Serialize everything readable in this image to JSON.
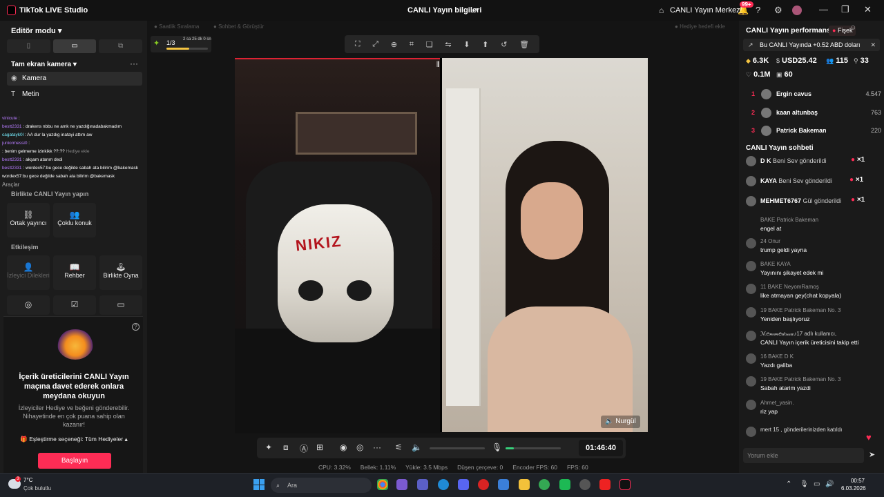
{
  "titlebar": {
    "app_title": "TikTok LIVE Studio",
    "center_title": "CANLI Yayın bilgileri",
    "live_center": "CANLI Yayın Merkezi",
    "notif_count": "99+"
  },
  "left": {
    "edit_mode": "Editör modu",
    "scene_label": "Tam ekran kamera",
    "sources": [
      "Kamera",
      "Metin"
    ],
    "chat_overlay": [
      {
        "name": "vinicute",
        "text": ""
      },
      {
        "name": "bestt2331",
        "text": "drakens nbbu ne amk ne yazdığınadabakmadım"
      },
      {
        "name": "cagatayk0l",
        "text": "AA dur la yazdıg inatayi attım aw"
      },
      {
        "name": "juniormessi0",
        "text": ""
      },
      {
        "name": "",
        "text": "benim gelmeme izinkikk ??:??"
      },
      {
        "name": "bestt2331",
        "text": "akşam atarım dedi"
      },
      {
        "name": "bestt2331",
        "text": "wordex57:bu gece değilde sabah ata bilirim @bakemask"
      },
      {
        "name": "",
        "text": "wordex57:bu gece değilde sabah ata bilirim @bakemask"
      }
    ],
    "chat_overlay_ghost": "Hediye ekle",
    "tools_label": "Araçlar",
    "together_section": "Birlikte CANLI Yayın yapın",
    "together_cards": [
      "Ortak yayıncı",
      "Çoklu konuk"
    ],
    "interaction_section": "Etkileşim",
    "interaction_cards": [
      "İzleyici Dilekleri",
      "Rehber",
      "Birlikte Oyna"
    ],
    "promo": {
      "title": "İçerik üreticilerini CANLI Yayın maçına davet ederek onlara meydana okuyun",
      "subtitle": "İzleyiciler Hediye ve beğeni gönderebilir. Nihayetinde en çok puana sahip olan kazanır!",
      "match_option": "Eşleştirme seçeneği: Tüm Hediyeler",
      "button": "Başlayın"
    }
  },
  "stage": {
    "ghost_tabs": [
      "Saatlik Sıralama",
      "Sohbet & Görüştür"
    ],
    "ghost_right": "Hediye hedefi ekle",
    "goal_fraction": "1/3",
    "goal_time": "2 sa 25 dk 0 sn",
    "goal_progress": 0.55,
    "guest_name": "Nurgül",
    "beanie_text": "NIKIZ",
    "timer": "01:46:40",
    "stats": {
      "cpu": "CPU: 3.32%",
      "memory": "Bellek: 1.11%",
      "upload": "Yükle: 3.5 Mbps",
      "dropped": "Düşen çerçeve: 0",
      "encoder_fps": "Encoder FPS: 60",
      "fps": "FPS: 60"
    },
    "mic_level": 0.15
  },
  "right": {
    "perf_title": "CANLI Yayın performansı",
    "fisek": "Fişek",
    "banner": "Bu CANLI Yayında +0.52 ABD doları",
    "stats": {
      "diamonds": "6.3K",
      "usd": "USD25.42",
      "viewers": "115",
      "new": "33",
      "likes": "0.1M",
      "shares": "60"
    },
    "ranking": [
      {
        "rank": "1",
        "name": "Ergin cavus",
        "value": "4.547"
      },
      {
        "rank": "2",
        "name": "kaan altunbaş",
        "value": "763"
      },
      {
        "rank": "3",
        "name": "Patrick Bakeman",
        "value": "220"
      }
    ],
    "chat_title": "CANLI Yayın sohbeti",
    "gifts": [
      {
        "user": "D K",
        "text": "Beni Sev gönderildi",
        "count": "×1"
      },
      {
        "user": "KAYA",
        "text": "Beni Sev gönderildi",
        "count": "×1"
      },
      {
        "user": "MEHMET6767",
        "text": "Gül gönderildi",
        "count": "×1"
      }
    ],
    "messages": [
      {
        "meta": "BAKE Patrick Bakeman",
        "text": "engel at"
      },
      {
        "meta": "24 Onur",
        "text": "trump geldi yayna"
      },
      {
        "meta": "BAKE KAYA",
        "text": "Yayınını şikayet edek mi"
      },
      {
        "meta": "11 BAKE NeyomRamoş",
        "text": "like atmayan gey(chat kopyala)"
      },
      {
        "meta": "19 BAKE Patrick Bakeman No. 3",
        "text": "Yeniden başlıyoruz"
      },
      {
        "meta": "ℳ𝑒𝓂𝓂𝑒𝒹ℴ𝓌𝒶♪17  adlı kullanıcı,",
        "text": "CANLI Yayın içerik üreticisini takip etti"
      },
      {
        "meta": "16 BAKE D K",
        "text": "Yazdı galiba"
      },
      {
        "meta": "19 BAKE Patrick Bakeman No. 3",
        "text": "Sabah atarim yazdi"
      },
      {
        "meta": "Ahmet_yasin.",
        "text": "riz yap"
      },
      {
        "meta": "mert 15 , gönderilerinizden katıldı",
        "text": ""
      }
    ],
    "comment_placeholder": "Yorum ekle"
  },
  "taskbar": {
    "temp": "7°C",
    "condition": "Çok bulutlu",
    "weather_badge": "3",
    "search_placeholder": "Ara",
    "time": "00:57",
    "date": "6.03.2026"
  }
}
